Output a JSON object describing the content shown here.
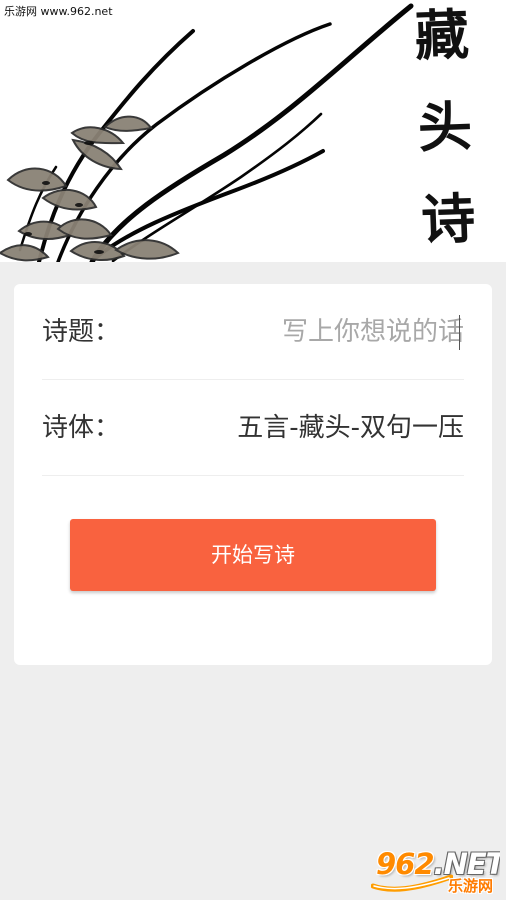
{
  "watermark": {
    "site_text": "乐游网 www.962.net",
    "logo_number": "962",
    "logo_suffix": ".NET",
    "logo_cn": "乐游网"
  },
  "header": {
    "title_chars": [
      "藏",
      "头",
      "诗"
    ]
  },
  "form": {
    "title_label": "诗题：",
    "title_placeholder": "写上你想说的话",
    "title_value": "",
    "style_label": "诗体：",
    "style_value": "五言-藏头-双句一压",
    "start_button_label": "开始写诗"
  },
  "colors": {
    "page_background": "#eeeeee",
    "card_background": "#ffffff",
    "accent_button": "#f9623f",
    "primary_text": "#333333",
    "placeholder_text": "#a8a8a8"
  },
  "icons": {
    "header_art": "orchid-ink-painting",
    "watermark_logo": "962-net-logo"
  }
}
